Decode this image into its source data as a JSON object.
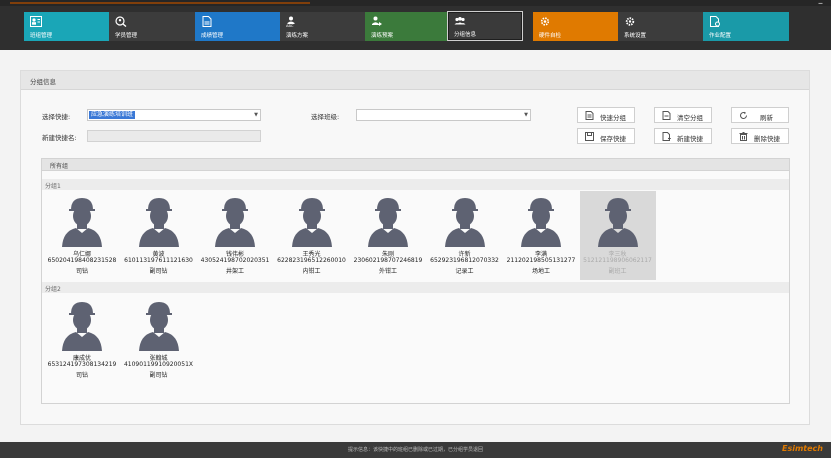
{
  "nav": {
    "tiles": [
      {
        "label": "班组管理",
        "color": "#1aa6b7",
        "icon": "roster-icon"
      },
      {
        "label": "学员管理",
        "color": "#3c3c3c",
        "icon": "search-person-icon"
      },
      {
        "label": "成绩管理",
        "color": "#1f78c8",
        "icon": "document-icon"
      },
      {
        "label": "演练方案",
        "color": "#3c3c3c",
        "icon": "abc-person-icon"
      },
      {
        "label": "演练预案",
        "color": "#3b7a3b",
        "icon": "plan-person-icon"
      },
      {
        "label": "分组信息",
        "color": "#3a3a3a",
        "icon": "group-icon"
      },
      {
        "label": "硬件自检",
        "color": "#e07a00",
        "icon": "hardware-gear-icon"
      },
      {
        "label": "系统设置",
        "color": "#3c3c3c",
        "icon": "gear-icon"
      },
      {
        "label": "作业配置",
        "color": "#1a9aa8",
        "icon": "config-doc-icon"
      }
    ],
    "active_index": 5
  },
  "panel": {
    "title": "分组信息",
    "select_quick_label": "选择快捷:",
    "select_quick_value": "应急演练培训班",
    "select_class_label": "选择班级:",
    "new_quick_label": "新建快捷名:",
    "new_quick_value": "",
    "buttons": {
      "quick_group": "快速分组",
      "clear_group": "清空分组",
      "refresh": "刷新",
      "save_quick": "保存快捷",
      "new_quick": "新建快捷",
      "delete_quick": "删除快捷"
    },
    "groups_header": "所有组",
    "group1_label": "分组1",
    "group2_label": "分组2",
    "group1": [
      {
        "name": "乌仁娜",
        "id": "650204198408231528",
        "role": "司钻"
      },
      {
        "name": "黄波",
        "id": "610113197611121630",
        "role": "副司钻"
      },
      {
        "name": "钱伟彬",
        "id": "430524198702020351",
        "role": "井架工"
      },
      {
        "name": "王秀光",
        "id": "622823196512260010",
        "role": "内钳工"
      },
      {
        "name": "朱刚",
        "id": "230602198707246819",
        "role": "外钳工"
      },
      {
        "name": "许新",
        "id": "652923196812070332",
        "role": "记录工"
      },
      {
        "name": "李满",
        "id": "211202198505131277",
        "role": "场地工"
      },
      {
        "name": "李三秋",
        "id": "512121198906062117",
        "role": "副班工"
      }
    ],
    "group2": [
      {
        "name": "康成优",
        "id": "653124197308134219",
        "role": "司钻"
      },
      {
        "name": "张翰城",
        "id": "41090119910920051X",
        "role": "副司钻"
      }
    ]
  },
  "footer": {
    "message": "提示信息：该快捷中的班组已删除或已过期，已分组学员退回",
    "brand": "Esimtech"
  }
}
